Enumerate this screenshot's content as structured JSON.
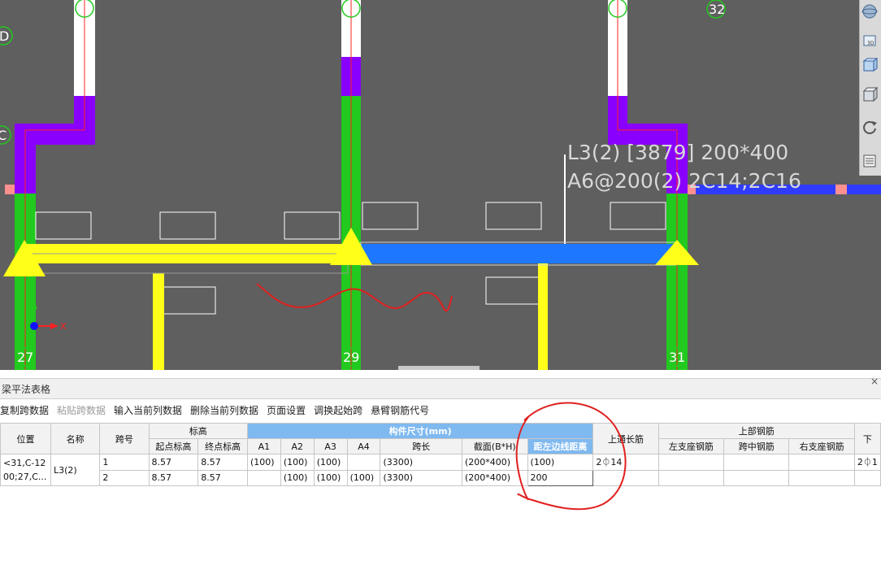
{
  "cad": {
    "axes_top": [
      "32"
    ],
    "axes_left": [
      "D",
      "C"
    ],
    "axes_bottom": [
      "27",
      "29",
      "31"
    ],
    "beam_annotation_line1": "L3(2) [3879] 200*400",
    "beam_annotation_line2": "A6@200(2) 2C14;2C16",
    "ucs_x_label": "X"
  },
  "panel": {
    "title": "梁平法表格",
    "close_glyph": "×"
  },
  "toolbar": {
    "copy_span": "复制跨数据",
    "paste_span": "粘贴跨数据",
    "input_column": "输入当前列数据",
    "delete_column": "删除当前列数据",
    "page_setup": "页面设置",
    "swap_start": "调换起始跨",
    "cantilever_code": "悬臂钢筋代号"
  },
  "table": {
    "headers": {
      "position": "位置",
      "name": "名称",
      "span_no": "跨号",
      "elevation": "标高",
      "start_elev": "起点标高",
      "end_elev": "终点标高",
      "member_size": "构件尺寸(mm)",
      "a1": "A1",
      "a2": "A2",
      "a3": "A3",
      "a4": "A4",
      "span_len": "跨长",
      "section": "截面(B*H)",
      "left_dist": "距左边线距离",
      "top_through": "上通长筋",
      "top_rebar": "上部钢筋",
      "left_support": "左支座钢筋",
      "mid_span": "跨中钢筋",
      "right_support": "右支座钢筋",
      "bottom": "下"
    },
    "position_value": "<31,C-1200;27,C...",
    "position_line1": "<31,C-12",
    "position_line2": "00;27,C...",
    "name_value": "L3(2)",
    "rows": [
      {
        "span": "1",
        "start": "8.57",
        "end": "8.57",
        "a1": "(100)",
        "a2": "(100)",
        "a3": "(100)",
        "a4": "",
        "len": "(3300)",
        "sec": "(200*400)",
        "dist": "(100)",
        "top_through": "2⏀14",
        "left_support": "",
        "mid_span": "",
        "right_support": "",
        "bottom": "2⏀1"
      },
      {
        "span": "2",
        "start": "8.57",
        "end": "8.57",
        "a1": "",
        "a2": "(100)",
        "a3": "(100)",
        "a4": "(100)",
        "len": "(3300)",
        "sec": "(200*400)",
        "dist": "200",
        "top_through": "",
        "left_support": "",
        "mid_span": "",
        "right_support": "",
        "bottom": ""
      }
    ]
  },
  "colors": {
    "cad_bg": "#5f5f5f",
    "column_green": "#22c91e",
    "wall_purple": "#8a00ff",
    "beam_yellow": "#ffff1a",
    "beam_blue": "#1e78ff",
    "axis_red": "#ff2020",
    "header_blue": "#7fb9ef",
    "markup_red": "#e0201e"
  }
}
